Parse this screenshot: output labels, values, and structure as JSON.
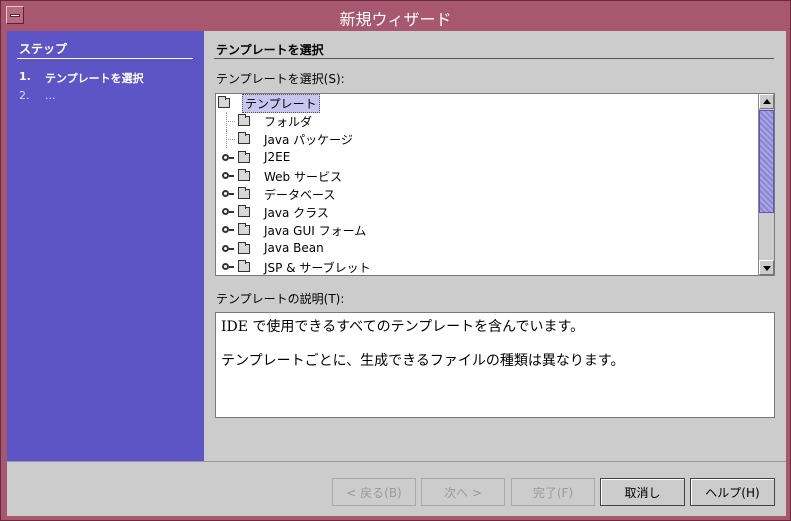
{
  "window": {
    "title": "新規ウィザード"
  },
  "steps": {
    "title": "ステップ",
    "items": [
      {
        "num": "1.",
        "label": "テンプレートを選択"
      },
      {
        "num": "2.",
        "label": "..."
      }
    ]
  },
  "main": {
    "title": "テンプレートを選択",
    "templates_label": "テンプレートを選択(S):",
    "tree": {
      "root": "テンプレート",
      "items": [
        {
          "label": "フォルダ",
          "expandable": false
        },
        {
          "label": "Java パッケージ",
          "expandable": false
        },
        {
          "label": "J2EE",
          "expandable": true
        },
        {
          "label": "Web サービス",
          "expandable": true
        },
        {
          "label": "データベース",
          "expandable": true
        },
        {
          "label": "Java クラス",
          "expandable": true
        },
        {
          "label": "Java GUI フォーム",
          "expandable": true
        },
        {
          "label": "Java Bean",
          "expandable": true
        },
        {
          "label": "JSP & サーブレット",
          "expandable": true
        }
      ]
    },
    "description_label": "テンプレートの説明(T):",
    "description": [
      "IDE で使用できるすべてのテンプレートを含んでいます。",
      "テンプレートごとに、生成できるファイルの種類は異なります。"
    ]
  },
  "buttons": {
    "back": "< 戻る(B)",
    "next": "次へ >",
    "finish": "完了(F)",
    "cancel": "取消し",
    "help": "ヘルプ(H)"
  },
  "colors": {
    "titlebar": "#a7576f",
    "steps_panel": "#5d55c6",
    "dialog_bg": "#cccccc"
  }
}
